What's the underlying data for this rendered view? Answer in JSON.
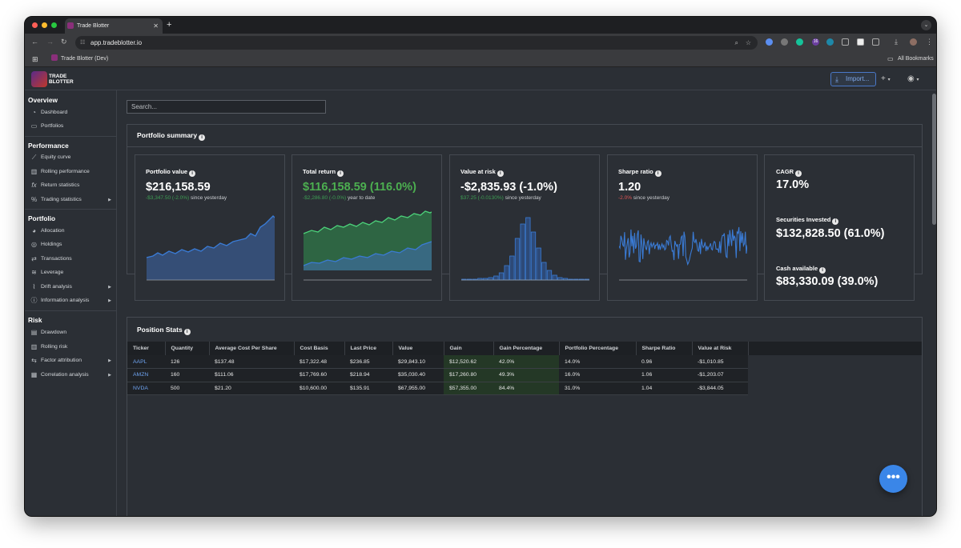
{
  "browser": {
    "tab_title": "Trade Blotter",
    "url": "app.tradeblotter.io",
    "bookmark": "Trade Blotter (Dev)",
    "all_bookmarks": "All Bookmarks",
    "extension_badge": "16"
  },
  "app": {
    "logo_line1": "TRADE",
    "logo_line2": "BLOTTER",
    "import_label": "Import..."
  },
  "sidebar": {
    "overview": {
      "title": "Overview",
      "items": [
        {
          "label": "Dashboard",
          "icon": "gauge-icon"
        },
        {
          "label": "Portfolios",
          "icon": "folder-icon"
        }
      ]
    },
    "performance": {
      "title": "Performance",
      "items": [
        {
          "label": "Equity curve",
          "icon": "line-chart-icon"
        },
        {
          "label": "Rolling performance",
          "icon": "bar-chart-icon"
        },
        {
          "label": "Return statistics",
          "icon": "function-icon"
        },
        {
          "label": "Trading statistics",
          "icon": "percent-icon"
        }
      ]
    },
    "portfolio": {
      "title": "Portfolio",
      "items": [
        {
          "label": "Allocation",
          "icon": "pie-icon"
        },
        {
          "label": "Holdings",
          "icon": "holdings-icon"
        },
        {
          "label": "Transactions",
          "icon": "transactions-icon"
        },
        {
          "label": "Leverage",
          "icon": "layers-icon"
        },
        {
          "label": "Drift analysis",
          "icon": "drift-icon"
        },
        {
          "label": "Information analysis",
          "icon": "info-icon"
        }
      ]
    },
    "risk": {
      "title": "Risk",
      "items": [
        {
          "label": "Drawdown",
          "icon": "drawdown-icon"
        },
        {
          "label": "Rolling risk",
          "icon": "bar-chart-icon"
        },
        {
          "label": "Factor attribution",
          "icon": "factor-icon"
        },
        {
          "label": "Correlation analysis",
          "icon": "grid-icon"
        }
      ]
    }
  },
  "search": {
    "placeholder": "Search..."
  },
  "summary": {
    "title": "Portfolio summary",
    "portfolio_value": {
      "label": "Portfolio value",
      "value": "$216,158.59",
      "change": "-$3,347.50 (-2.0%)",
      "suffix": " since yesterday"
    },
    "total_return": {
      "label": "Total return",
      "value": "$116,158.59 (116.0%)",
      "change": "-$2,286.80 (-0.0%)",
      "suffix": " year to date"
    },
    "value_at_risk": {
      "label": "Value at risk",
      "value": "-$2,835.93 (-1.0%)",
      "change": "$37.25 (-0.0130%)",
      "suffix": " since yesterday"
    },
    "sharpe": {
      "label": "Sharpe ratio",
      "value": "1.20",
      "change": "-2.0%",
      "suffix": " since yesterday"
    },
    "cagr": {
      "label": "CAGR",
      "value": "17.0%"
    },
    "securities": {
      "label": "Securities Invested",
      "value": "$132,828.50 (61.0%)"
    },
    "cash": {
      "label": "Cash available",
      "value": "$83,330.09 (39.0%)"
    }
  },
  "positions": {
    "title": "Position Stats",
    "columns": [
      "Ticker",
      "Quantity",
      "Average Cost Per Share",
      "Cost Basis",
      "Last Price",
      "Value",
      "Gain",
      "Gain Percentage",
      "Portfolio Percentage",
      "Sharpe Ratio",
      "Value at Risk"
    ],
    "rows": [
      [
        "AAPL",
        "126",
        "$137.48",
        "$17,322.48",
        "$236.85",
        "$29,843.10",
        "$12,520.62",
        "42.0%",
        "14.0%",
        "0.96",
        "-$1,010.85"
      ],
      [
        "AMZN",
        "160",
        "$111.06",
        "$17,769.60",
        "$218.94",
        "$35,030.40",
        "$17,260.80",
        "49.3%",
        "16.0%",
        "1.06",
        "-$1,203.07"
      ],
      [
        "NVDA",
        "500",
        "$21.20",
        "$10,600.00",
        "$135.91",
        "$67,955.00",
        "$57,355.00",
        "84.4%",
        "31.0%",
        "1.04",
        "-$3,844.05"
      ]
    ]
  },
  "colors": {
    "accent_blue": "#3a7bd5",
    "green": "#4caf50",
    "red": "#e05555",
    "panel_bg": "#2b2f35"
  }
}
